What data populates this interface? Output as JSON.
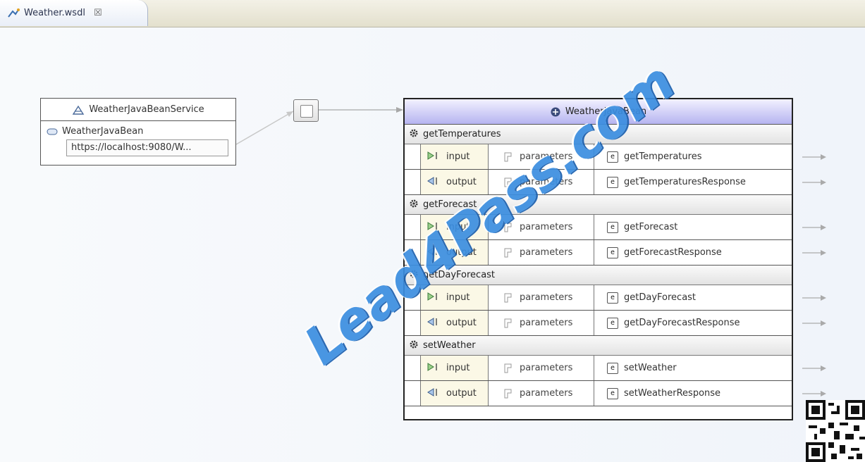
{
  "tab": {
    "title": "Weather.wsdl",
    "close_glyph": "☒"
  },
  "service": {
    "name": "WeatherJavaBeanService",
    "port_name": "WeatherJavaBean",
    "address": "https://localhost:9080/W..."
  },
  "port_type": {
    "name": "WeatherJavaBean",
    "operations": [
      {
        "name": "getTemperatures",
        "messages": [
          {
            "direction": "input",
            "part": "parameters",
            "element": "getTemperatures"
          },
          {
            "direction": "output",
            "part": "parameters",
            "element": "getTemperaturesResponse"
          }
        ]
      },
      {
        "name": "getForecast",
        "messages": [
          {
            "direction": "input",
            "part": "parameters",
            "element": "getForecast"
          },
          {
            "direction": "output",
            "part": "parameters",
            "element": "getForecastResponse"
          }
        ]
      },
      {
        "name": "getDayForecast",
        "messages": [
          {
            "direction": "input",
            "part": "parameters",
            "element": "getDayForecast"
          },
          {
            "direction": "output",
            "part": "parameters",
            "element": "getDayForecastResponse"
          }
        ]
      },
      {
        "name": "setWeather",
        "messages": [
          {
            "direction": "input",
            "part": "parameters",
            "element": "setWeather"
          },
          {
            "direction": "output",
            "part": "parameters",
            "element": "setWeatherResponse"
          }
        ]
      }
    ]
  },
  "watermark": "Lead4Pass.com",
  "element_badge": "e",
  "icons": {
    "service": "service-icon",
    "port": "port-icon",
    "port_type": "port-type-icon",
    "operation": "gear-icon",
    "input": "input-arrow-icon",
    "output": "output-arrow-icon",
    "part": "part-icon",
    "element": "element-icon"
  },
  "colors": {
    "port_type_header": "#b6b4f0",
    "message_cell": "#fbf8e6",
    "watermark": "#3b8ee0"
  }
}
